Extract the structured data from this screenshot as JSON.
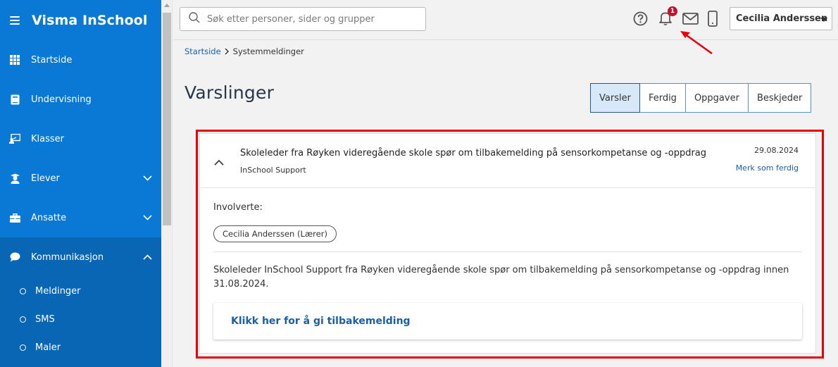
{
  "app": {
    "title": "Visma InSchool"
  },
  "sidebar": {
    "items": [
      {
        "label": "Startside",
        "icon": "grid-icon",
        "chevron": ""
      },
      {
        "label": "Undervisning",
        "icon": "book-icon",
        "chevron": ""
      },
      {
        "label": "Klasser",
        "icon": "presentation-icon",
        "chevron": ""
      },
      {
        "label": "Elever",
        "icon": "student-icon",
        "chevron": "down"
      },
      {
        "label": "Ansatte",
        "icon": "briefcase-icon",
        "chevron": "down"
      },
      {
        "label": "Kommunikasjon",
        "icon": "chat-icon",
        "chevron": "up"
      }
    ],
    "subitems": [
      {
        "label": "Meldinger"
      },
      {
        "label": "SMS"
      },
      {
        "label": "Maler"
      }
    ]
  },
  "header": {
    "search_placeholder": "Søk etter personer, sider og grupper",
    "notification_count": "1",
    "user_name": "Cecilia Anderssen"
  },
  "breadcrumb": {
    "home": "Startside",
    "current": "Systemmeldinger"
  },
  "page": {
    "title": "Varslinger"
  },
  "tabs": [
    {
      "label": "Varsler",
      "active": true
    },
    {
      "label": "Ferdig",
      "active": false
    },
    {
      "label": "Oppgaver",
      "active": false
    },
    {
      "label": "Beskjeder",
      "active": false
    }
  ],
  "notification": {
    "subject": "Skoleleder fra Røyken videregående skole spør om tilbakemelding på sensorkompetanse og -oppdrag",
    "sender": "InSchool Support",
    "date": "29.08.2024",
    "action": "Merk som ferdig",
    "involved_label": "Involverte:",
    "involved": [
      "Cecilia Anderssen (Lærer)"
    ],
    "body": "Skoleleder InSchool Support fra Røyken videregående skole spør om tilbakemelding på sensorkompetanse og -oppdrag innen 31.08.2024.",
    "feedback_link": "Klikk her for å gi tilbakemelding"
  },
  "colors": {
    "sidebar": "#0a79d6",
    "sidebar_active": "#0866b5",
    "link": "#1a5fa8",
    "badge": "#c8102e",
    "annotation": "#e8000b"
  }
}
